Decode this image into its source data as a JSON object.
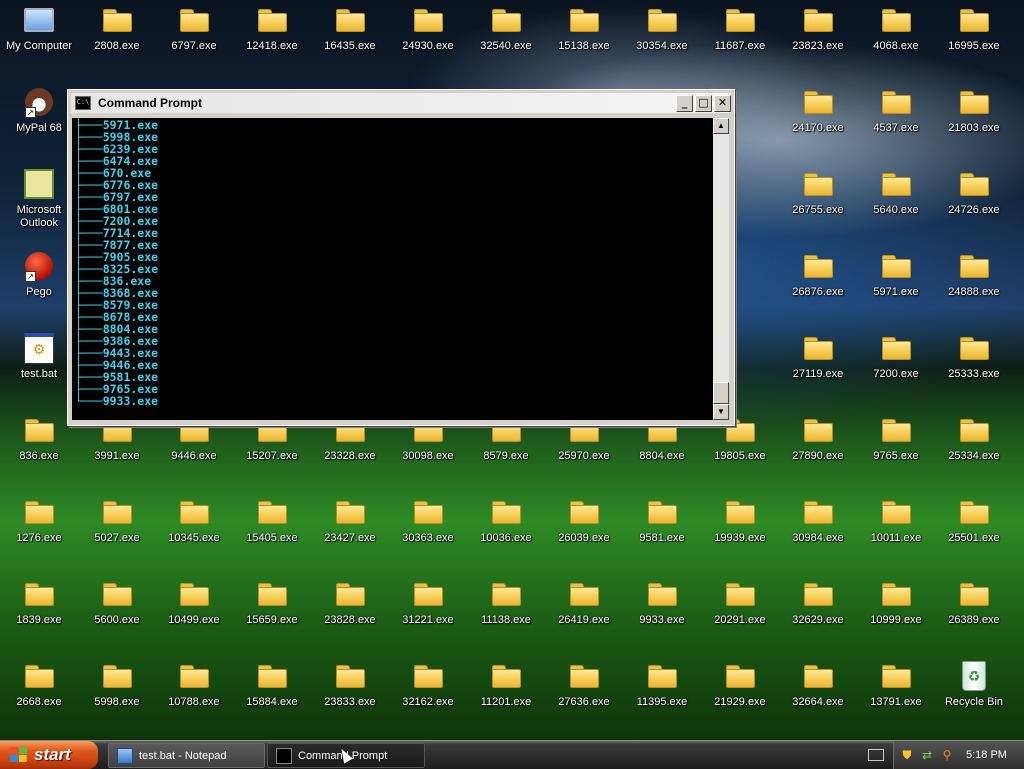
{
  "desktop": {
    "icons": [
      {
        "label": "My Computer",
        "type": "computer"
      },
      {
        "label": "2808.exe",
        "type": "folder"
      },
      {
        "label": "6797.exe",
        "type": "folder"
      },
      {
        "label": "12418.exe",
        "type": "folder"
      },
      {
        "label": "16435.exe",
        "type": "folder"
      },
      {
        "label": "24930.exe",
        "type": "folder"
      },
      {
        "label": "32540.exe",
        "type": "folder"
      },
      {
        "label": "15138.exe",
        "type": "folder"
      },
      {
        "label": "30354.exe",
        "type": "folder"
      },
      {
        "label": "11687.exe",
        "type": "folder"
      },
      {
        "label": "23823.exe",
        "type": "folder"
      },
      {
        "label": "4068.exe",
        "type": "folder"
      },
      {
        "label": "16995.exe",
        "type": "folder"
      },
      {
        "label": "MyPal 68",
        "type": "mypal"
      },
      {
        "label": "24170.exe",
        "type": "folder"
      },
      {
        "label": "4537.exe",
        "type": "folder"
      },
      {
        "label": "21803.exe",
        "type": "folder"
      },
      {
        "label": "Microsoft Outlook",
        "type": "outlook"
      },
      {
        "label": "26755.exe",
        "type": "folder"
      },
      {
        "label": "5640.exe",
        "type": "folder"
      },
      {
        "label": "24726.exe",
        "type": "folder"
      },
      {
        "label": "Pego",
        "type": "pego"
      },
      {
        "label": "26876.exe",
        "type": "folder"
      },
      {
        "label": "5971.exe",
        "type": "folder"
      },
      {
        "label": "24888.exe",
        "type": "folder"
      },
      {
        "label": "test.bat",
        "type": "bat"
      },
      {
        "label": "27119.exe",
        "type": "folder"
      },
      {
        "label": "7200.exe",
        "type": "folder"
      },
      {
        "label": "25333.exe",
        "type": "folder"
      },
      {
        "label": "836.exe",
        "type": "folder"
      },
      {
        "label": "3991.exe",
        "type": "folder"
      },
      {
        "label": "9446.exe",
        "type": "folder"
      },
      {
        "label": "15207.exe",
        "type": "folder"
      },
      {
        "label": "23328.exe",
        "type": "folder"
      },
      {
        "label": "30098.exe",
        "type": "folder"
      },
      {
        "label": "8579.exe",
        "type": "folder"
      },
      {
        "label": "25970.exe",
        "type": "folder"
      },
      {
        "label": "8804.exe",
        "type": "folder"
      },
      {
        "label": "19805.exe",
        "type": "folder"
      },
      {
        "label": "27890.exe",
        "type": "folder"
      },
      {
        "label": "9765.exe",
        "type": "folder"
      },
      {
        "label": "25334.exe",
        "type": "folder"
      },
      {
        "label": "1276.exe",
        "type": "folder"
      },
      {
        "label": "5027.exe",
        "type": "folder"
      },
      {
        "label": "10345.exe",
        "type": "folder"
      },
      {
        "label": "15405.exe",
        "type": "folder"
      },
      {
        "label": "23427.exe",
        "type": "folder"
      },
      {
        "label": "30363.exe",
        "type": "folder"
      },
      {
        "label": "10036.exe",
        "type": "folder"
      },
      {
        "label": "26039.exe",
        "type": "folder"
      },
      {
        "label": "9581.exe",
        "type": "folder"
      },
      {
        "label": "19939.exe",
        "type": "folder"
      },
      {
        "label": "30984.exe",
        "type": "folder"
      },
      {
        "label": "10011.exe",
        "type": "folder"
      },
      {
        "label": "25501.exe",
        "type": "folder"
      },
      {
        "label": "1839.exe",
        "type": "folder"
      },
      {
        "label": "5600.exe",
        "type": "folder"
      },
      {
        "label": "10499.exe",
        "type": "folder"
      },
      {
        "label": "15659.exe",
        "type": "folder"
      },
      {
        "label": "23828.exe",
        "type": "folder"
      },
      {
        "label": "31221.exe",
        "type": "folder"
      },
      {
        "label": "11138.exe",
        "type": "folder"
      },
      {
        "label": "26419.exe",
        "type": "folder"
      },
      {
        "label": "9933.exe",
        "type": "folder"
      },
      {
        "label": "20291.exe",
        "type": "folder"
      },
      {
        "label": "32629.exe",
        "type": "folder"
      },
      {
        "label": "10999.exe",
        "type": "folder"
      },
      {
        "label": "26389.exe",
        "type": "folder"
      },
      {
        "label": "2668.exe",
        "type": "folder"
      },
      {
        "label": "5998.exe",
        "type": "folder"
      },
      {
        "label": "10788.exe",
        "type": "folder"
      },
      {
        "label": "15884.exe",
        "type": "folder"
      },
      {
        "label": "23833.exe",
        "type": "folder"
      },
      {
        "label": "32162.exe",
        "type": "folder"
      },
      {
        "label": "11201.exe",
        "type": "folder"
      },
      {
        "label": "27636.exe",
        "type": "folder"
      },
      {
        "label": "11395.exe",
        "type": "folder"
      },
      {
        "label": "21929.exe",
        "type": "folder"
      },
      {
        "label": "32664.exe",
        "type": "folder"
      },
      {
        "label": "13791.exe",
        "type": "folder"
      },
      {
        "label": "Recycle Bin",
        "type": "recycle"
      }
    ]
  },
  "window": {
    "title": "Command Prompt",
    "minimize_label": "_",
    "maximize_label": "□",
    "close_label": "✕",
    "app_icon_text": "C:\\",
    "lines": [
      "├───5971.exe",
      "├───5998.exe",
      "├───6239.exe",
      "├───6474.exe",
      "├───670.exe",
      "├───6776.exe",
      "├───6797.exe",
      "├───6801.exe",
      "├───7200.exe",
      "├───7714.exe",
      "├───7877.exe",
      "├───7905.exe",
      "├───8325.exe",
      "├───836.exe",
      "├───8368.exe",
      "├───8579.exe",
      "├───8678.exe",
      "├───8804.exe",
      "├───9386.exe",
      "├───9443.exe",
      "├───9446.exe",
      "├───9581.exe",
      "├───9765.exe",
      "└───9933.exe"
    ],
    "text_color": "#3fd3ee"
  },
  "taskbar": {
    "start_label": "start",
    "tasks": [
      {
        "label": "test.bat - Notepad",
        "icon": "notepad-icon"
      },
      {
        "label": "Command Prompt",
        "icon": "cmd-icon"
      }
    ],
    "clock": "5:18 PM"
  }
}
